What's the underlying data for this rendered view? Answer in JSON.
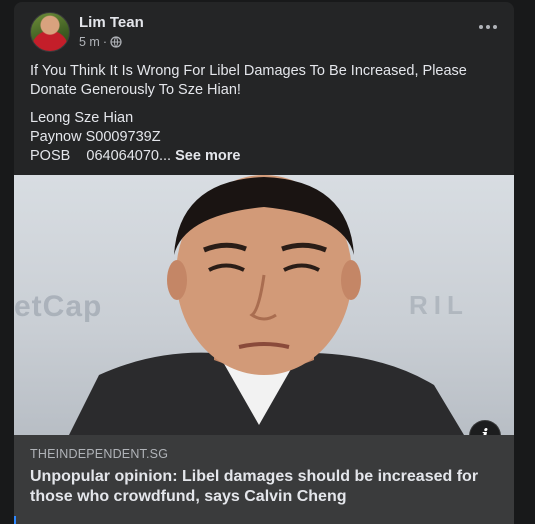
{
  "post": {
    "author": "Lim Tean",
    "time": "5 m",
    "separator": "·",
    "privacy_icon": "globe-icon",
    "menu_icon": "more-options-icon",
    "body_line1": "If You Think It Is Wrong For Libel Damages To Be Increased, Please Donate Generously To Sze Hian!",
    "body_line2": "Leong Sze Hian",
    "body_line3": "Paynow S0009739Z",
    "body_line4": "POSB    064064070...",
    "see_more": "See more"
  },
  "image": {
    "watermark_left": "etCap",
    "watermark_right": "RIL"
  },
  "link": {
    "domain": "THEINDEPENDENT.SG",
    "title": "Unpopular opinion: Libel damages should be increased for those who crowdfund, says Calvin Cheng",
    "info_icon": "info-icon"
  },
  "colors": {
    "background": "#18191a",
    "card": "#242526",
    "link_box": "#3a3b3c",
    "text_primary": "#e4e6eb",
    "text_secondary": "#b0b3b8",
    "accent": "#2d88ff"
  }
}
